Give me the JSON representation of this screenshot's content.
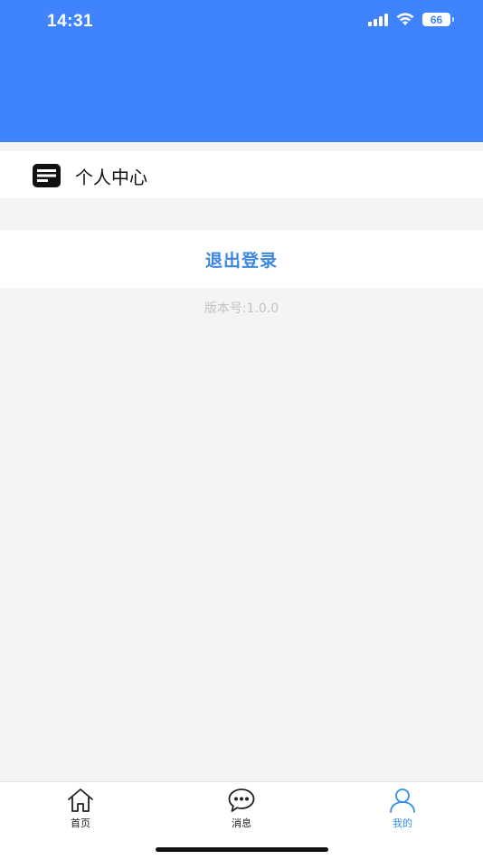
{
  "status_bar": {
    "time": "14:31",
    "battery": "66"
  },
  "header": {
    "background": "#3f83ff"
  },
  "profile_menu": {
    "personal_center_label": "个人中心",
    "personal_center_icon": "document-icon"
  },
  "actions": {
    "logout_label": "退出登录",
    "logout_color": "#3d86e0"
  },
  "app_info": {
    "version_text": "版本号:1.0.0"
  },
  "tabbar": {
    "tabs": [
      {
        "label": "首页",
        "icon": "home-icon",
        "active": false
      },
      {
        "label": "消息",
        "icon": "chat-bubble-icon",
        "active": false
      },
      {
        "label": "我的",
        "icon": "user-icon",
        "active": true
      }
    ],
    "active_color": "#2f8ff0"
  }
}
